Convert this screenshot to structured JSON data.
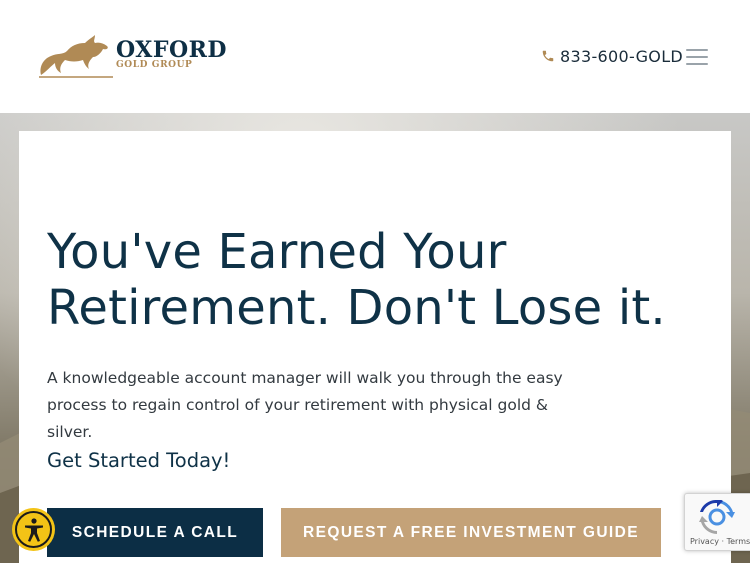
{
  "brand": {
    "name": "OXFORD",
    "tagline": "GOLD GROUP",
    "gold_color": "#b08a55",
    "navy_color": "#0e2f45"
  },
  "header": {
    "phone": "833-600-GOLD",
    "phone_icon": "phone-icon",
    "menu_icon": "hamburger-menu-icon"
  },
  "hero": {
    "headline": "You've Earned Your Retirement. Don't Lose it.",
    "subtext": "A knowledgeable account manager will walk you through the easy process to regain control of your retirement with physical gold & silver.",
    "cta_text": "Get Started Today!",
    "primary_button": "SCHEDULE A CALL",
    "secondary_button": "REQUEST A FREE INVESTMENT GUIDE",
    "primary_color": "#0c2e45",
    "secondary_color": "#c4a278"
  },
  "widgets": {
    "accessibility_icon": "accessibility-icon",
    "recaptcha_links": "Privacy · Terms"
  }
}
